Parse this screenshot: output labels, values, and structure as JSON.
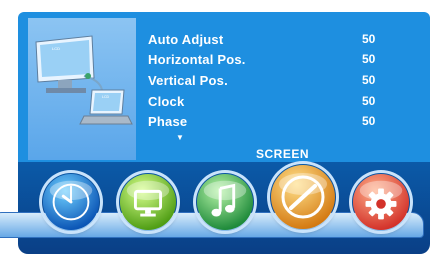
{
  "menu": {
    "items": [
      {
        "label": "Auto Adjust",
        "value": "50"
      },
      {
        "label": "Horizontal Pos.",
        "value": "50"
      },
      {
        "label": "Vertical Pos.",
        "value": "50"
      },
      {
        "label": "Clock",
        "value": "50"
      },
      {
        "label": "Phase",
        "value": "50"
      }
    ],
    "more_indicator": "▼",
    "title": "SCREEN"
  },
  "icons": [
    "clock-icon",
    "monitor-icon",
    "music-icon",
    "screen-dial-icon",
    "settings-gear-icon"
  ],
  "colors": {
    "background_blue": "#1e8fe0",
    "bottom_blue": "#0a3f86",
    "text": "#ffffff"
  }
}
